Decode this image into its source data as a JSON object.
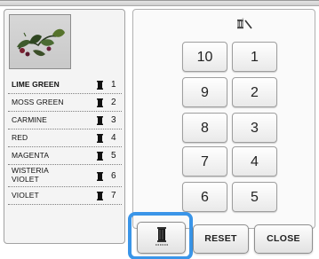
{
  "colors": [
    {
      "name": "LIME GREEN",
      "number": "1",
      "selected": true
    },
    {
      "name": "MOSS GREEN",
      "number": "2"
    },
    {
      "name": "CARMINE",
      "number": "3"
    },
    {
      "name": "RED",
      "number": "4"
    },
    {
      "name": "MAGENTA",
      "number": "5"
    },
    {
      "name": "WISTERIA VIOLET",
      "number": "6"
    },
    {
      "name": "VIOLET",
      "number": "7"
    }
  ],
  "number_buttons": [
    "10",
    "1",
    "9",
    "2",
    "8",
    "3",
    "7",
    "4",
    "6",
    "5"
  ],
  "buttons": {
    "thread_icon": "thread-spool-icon",
    "reset": "RESET",
    "close": "CLOSE"
  },
  "icons": {
    "wand": "magic-wand-spool-icon",
    "preview": "embroidery-pattern-preview"
  },
  "accent_color": "#3a95e8"
}
